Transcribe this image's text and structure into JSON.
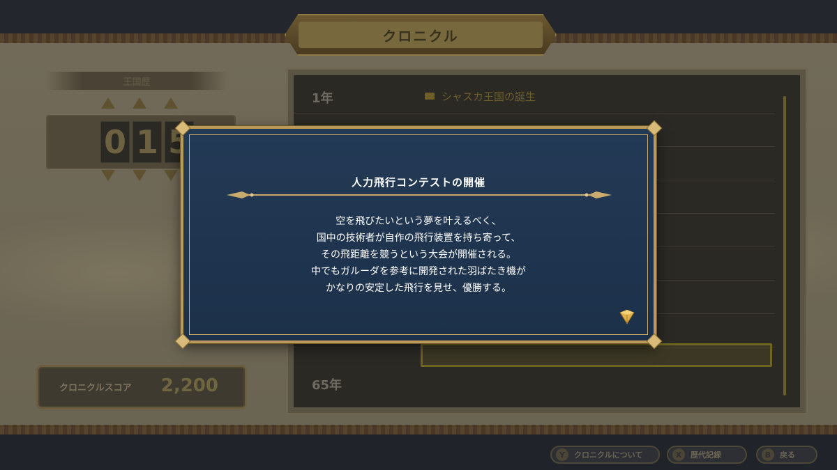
{
  "screen": {
    "title": "クロニクル"
  },
  "year_panel": {
    "label": "王国歴",
    "digits": [
      "0",
      "1",
      "5"
    ]
  },
  "score": {
    "label": "クロニクルスコア",
    "value": "2,200"
  },
  "timeline": {
    "rows": [
      {
        "year": "1年",
        "event": "シャスカ王国の誕生"
      },
      {
        "year": "",
        "event": ""
      },
      {
        "year": "",
        "event": ""
      },
      {
        "year": "",
        "event": ""
      },
      {
        "year": "",
        "event": ""
      },
      {
        "year": "",
        "event": ""
      },
      {
        "year": "",
        "event": ""
      },
      {
        "year": "",
        "event": ""
      },
      {
        "year": "65年",
        "event": ""
      }
    ],
    "highlighted_event": "人力飛行コンテストの開催"
  },
  "dialog": {
    "title": "人力飛行コンテストの開催",
    "lines": [
      "空を飛びたいという夢を叶えるべく、",
      "国中の技術者が自作の飛行装置を持ち寄って、",
      "その飛距離を競うという大会が開催される。",
      "中でもガルーダを参考に開発された羽ばたき機が",
      "かなりの安定した飛行を見せ、優勝する。"
    ]
  },
  "footer_buttons": [
    {
      "key": "Y",
      "label": "クロニクルについて"
    },
    {
      "key": "X",
      "label": "歴代記録"
    },
    {
      "key": "B",
      "label": "戻る"
    }
  ],
  "colors": {
    "dialog_bg": "#1f344f",
    "dialog_border": "#b99a5a",
    "gold": "#d8bb79",
    "dim_overlay_text": "#6e5e2a"
  }
}
